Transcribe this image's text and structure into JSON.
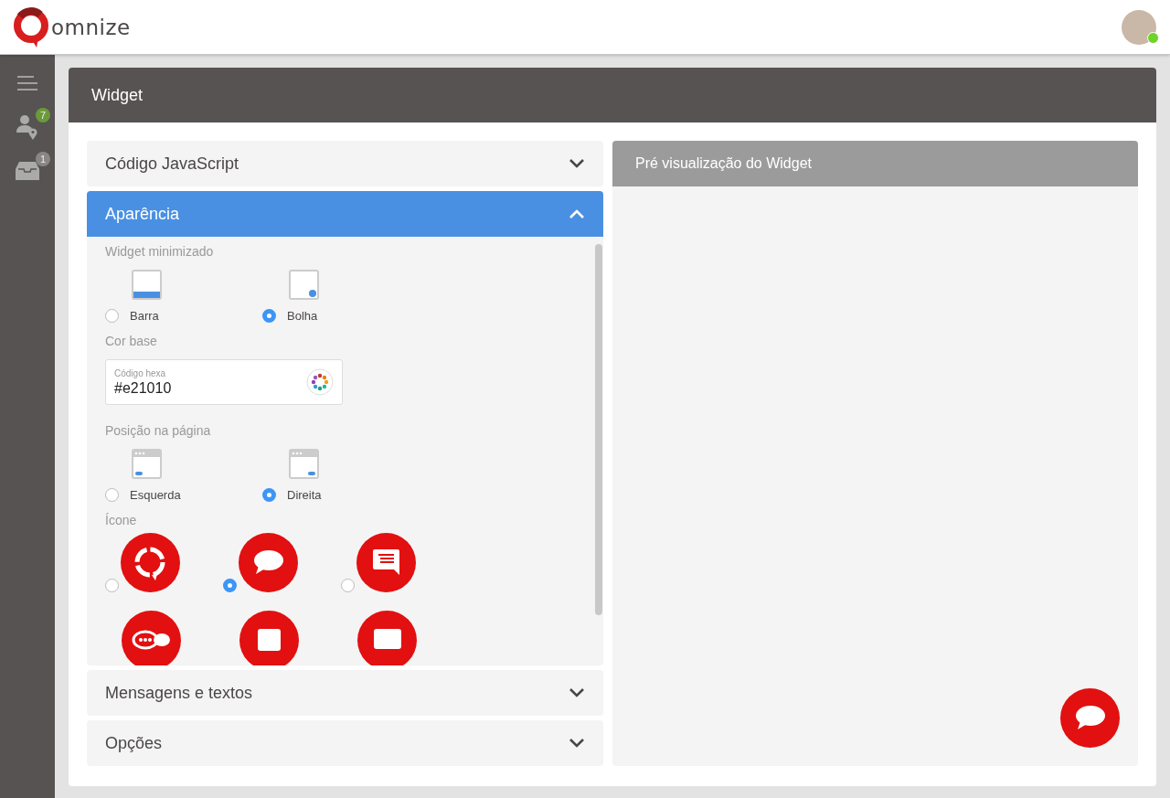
{
  "header": {
    "brand": "omnize",
    "user": {
      "online": true
    }
  },
  "sidebar": {
    "items": [
      {
        "kind": "menu"
      },
      {
        "kind": "contacts",
        "badge": "7",
        "color": "#6b9a3a"
      },
      {
        "kind": "inbox",
        "badge": "1",
        "color": "#8a8685"
      }
    ]
  },
  "page": {
    "title": "Widget"
  },
  "sections": [
    {
      "title": "Código JavaScript",
      "expanded": false
    },
    {
      "title": "Aparência",
      "expanded": true
    },
    {
      "title": "Mensagens e textos",
      "expanded": false
    },
    {
      "title": "Opções",
      "expanded": false
    }
  ],
  "appearance": {
    "widget_minimized": {
      "label": "Widget minimizado",
      "options": [
        {
          "kind": "bar",
          "label": "Barra",
          "selected": false
        },
        {
          "kind": "bubble",
          "label": "Bolha",
          "selected": true
        }
      ]
    },
    "base_color": {
      "label": "Cor base",
      "field_label": "Código hexa",
      "value": "#e21010"
    },
    "position": {
      "label": "Posição na página",
      "options": [
        {
          "kind": "left",
          "label": "Esquerda",
          "selected": false
        },
        {
          "kind": "right",
          "label": "Direita",
          "selected": true
        }
      ]
    },
    "icon": {
      "label": "Ícone",
      "options": [
        {
          "kind": "logo",
          "selected": false
        },
        {
          "kind": "bubble",
          "selected": true
        },
        {
          "kind": "message",
          "selected": false
        }
      ],
      "partial_options": [
        {
          "kind": "dots"
        },
        {
          "kind": "square"
        },
        {
          "kind": "box"
        }
      ]
    }
  },
  "preview": {
    "title": "Pré visualização do Widget",
    "button": {
      "kind": "bubble"
    }
  }
}
